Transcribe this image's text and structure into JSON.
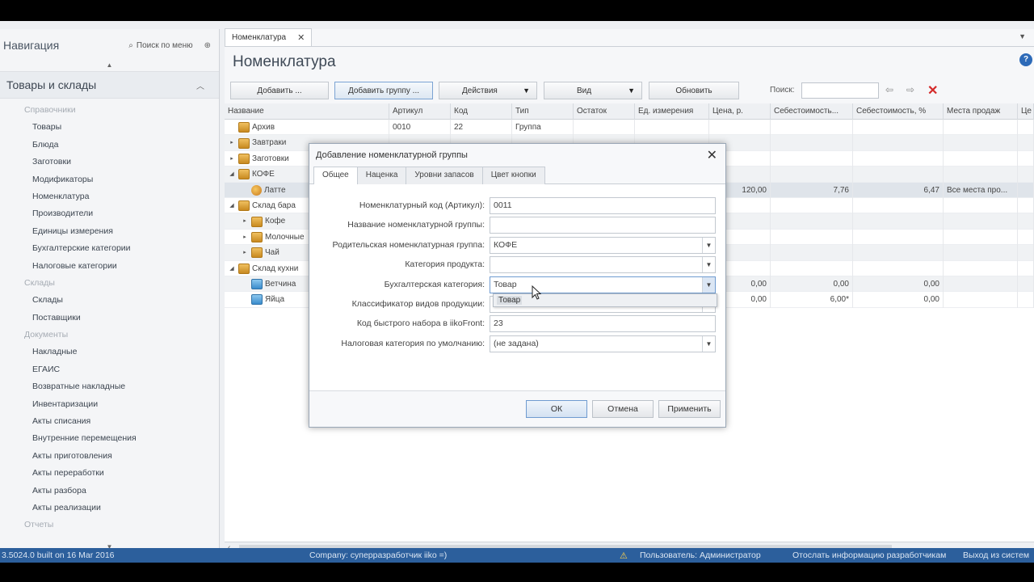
{
  "nav": {
    "title": "Навигация",
    "search_label": "Поиск по меню",
    "section_title": "Товары и склады",
    "groups": [
      {
        "type": "group",
        "label": "Справочники"
      },
      {
        "type": "item",
        "label": "Товары"
      },
      {
        "type": "item",
        "label": "Блюда"
      },
      {
        "type": "item",
        "label": "Заготовки"
      },
      {
        "type": "item",
        "label": "Модификаторы"
      },
      {
        "type": "item",
        "label": "Номенклатура"
      },
      {
        "type": "item",
        "label": "Производители"
      },
      {
        "type": "item",
        "label": "Единицы измерения"
      },
      {
        "type": "item",
        "label": "Бухгалтерские категории"
      },
      {
        "type": "item",
        "label": "Налоговые категории"
      },
      {
        "type": "group",
        "label": "Склады"
      },
      {
        "type": "item",
        "label": "Склады"
      },
      {
        "type": "item",
        "label": "Поставщики"
      },
      {
        "type": "group",
        "label": "Документы"
      },
      {
        "type": "item",
        "label": "Накладные"
      },
      {
        "type": "item",
        "label": "ЕГАИС"
      },
      {
        "type": "item",
        "label": "Возвратные накладные"
      },
      {
        "type": "item",
        "label": "Инвентаризации"
      },
      {
        "type": "item",
        "label": "Акты списания"
      },
      {
        "type": "item",
        "label": "Внутренние перемещения"
      },
      {
        "type": "item",
        "label": "Акты приготовления"
      },
      {
        "type": "item",
        "label": "Акты переработки"
      },
      {
        "type": "item",
        "label": "Акты разбора"
      },
      {
        "type": "item",
        "label": "Акты реализации"
      },
      {
        "type": "group",
        "label": "Отчеты"
      }
    ]
  },
  "main": {
    "tab_label": "Номенклатура",
    "page_title": "Номенклатура",
    "toolbar": {
      "add": "Добавить ...",
      "add_group": "Добавить группу ...",
      "actions": "Действия",
      "view": "Вид",
      "refresh": "Обновить",
      "search_label": "Поиск:",
      "search_value": ""
    },
    "columns": [
      "Название",
      "Артикул",
      "Код",
      "Тип",
      "Остаток",
      "Ед. измерения",
      "Цена, р.",
      "Себестоимость...",
      "Себестоимость, %",
      "Места продаж",
      "Це"
    ],
    "rows": [
      {
        "level": 0,
        "expand": "",
        "icon": "folder",
        "name": "Архив",
        "article": "0010",
        "code": "22",
        "type": "Группа",
        "stock": "",
        "unit": "",
        "price": "",
        "cost": "",
        "cost_pct": "",
        "places": "",
        "style": ""
      },
      {
        "level": 0,
        "expand": "▸",
        "icon": "folder",
        "name": "Завтраки",
        "article": "",
        "code": "",
        "type": "",
        "stock": "",
        "unit": "",
        "price": "",
        "cost": "",
        "cost_pct": "",
        "places": "",
        "style": "alt"
      },
      {
        "level": 0,
        "expand": "▸",
        "icon": "folder",
        "name": "Заготовки",
        "article": "",
        "code": "",
        "type": "",
        "stock": "",
        "unit": "",
        "price": "",
        "cost": "",
        "cost_pct": "",
        "places": "",
        "style": ""
      },
      {
        "level": 0,
        "expand": "◢",
        "icon": "folder",
        "name": "КОФЕ",
        "article": "",
        "code": "",
        "type": "",
        "stock": "",
        "unit": "",
        "price": "",
        "cost": "",
        "cost_pct": "",
        "places": "",
        "style": "alt"
      },
      {
        "level": 1,
        "expand": "",
        "icon": "food",
        "name": "Латте",
        "article": "",
        "code": "",
        "type": "",
        "stock": "",
        "unit": "",
        "price": "120,00",
        "cost": "7,76",
        "cost_pct": "6,47",
        "places": "Все места про...",
        "style": "sel"
      },
      {
        "level": 0,
        "expand": "◢",
        "icon": "folder",
        "name": "Склад бара",
        "article": "",
        "code": "",
        "type": "",
        "stock": "",
        "unit": "",
        "price": "",
        "cost": "",
        "cost_pct": "",
        "places": "",
        "style": ""
      },
      {
        "level": 1,
        "expand": "▸",
        "icon": "folder",
        "name": "Кофе",
        "article": "",
        "code": "",
        "type": "",
        "stock": "",
        "unit": "",
        "price": "",
        "cost": "",
        "cost_pct": "",
        "places": "",
        "style": "alt"
      },
      {
        "level": 1,
        "expand": "▸",
        "icon": "folder",
        "name": "Молочные",
        "article": "",
        "code": "",
        "type": "",
        "stock": "",
        "unit": "",
        "price": "",
        "cost": "",
        "cost_pct": "",
        "places": "",
        "style": ""
      },
      {
        "level": 1,
        "expand": "▸",
        "icon": "folder",
        "name": "Чай",
        "article": "",
        "code": "",
        "type": "",
        "stock": "",
        "unit": "",
        "price": "",
        "cost": "",
        "cost_pct": "",
        "places": "",
        "style": "alt"
      },
      {
        "level": 0,
        "expand": "◢",
        "icon": "folder",
        "name": "Склад кухни",
        "article": "",
        "code": "",
        "type": "",
        "stock": "",
        "unit": "",
        "price": "",
        "cost": "",
        "cost_pct": "",
        "places": "",
        "style": ""
      },
      {
        "level": 1,
        "expand": "",
        "icon": "item",
        "name": "Ветчина",
        "article": "",
        "code": "",
        "type": "",
        "stock": "",
        "unit": "",
        "price": "0,00",
        "cost": "0,00",
        "cost_pct": "0,00",
        "places": "",
        "style": "alt"
      },
      {
        "level": 1,
        "expand": "",
        "icon": "item",
        "name": "Яйца",
        "article": "",
        "code": "",
        "type": "",
        "stock": "",
        "unit": "",
        "price": "0,00",
        "cost": "6,00*",
        "cost_pct": "0,00",
        "places": "",
        "style": ""
      }
    ]
  },
  "dialog": {
    "title": "Добавление номенклатурной группы",
    "tabs": [
      "Общее",
      "Наценка",
      "Уровни запасов",
      "Цвет кнопки"
    ],
    "fields": [
      {
        "label": "Номенклатурный код (Артикул):",
        "value": "0011",
        "combo": false
      },
      {
        "label": "Название номенклатурной группы:",
        "value": "",
        "combo": false
      },
      {
        "label": "Родительская номенклатурная группа:",
        "value": "КОФЕ",
        "combo": true
      },
      {
        "label": "Категория продукта:",
        "value": "",
        "combo": true
      },
      {
        "label": "Бухгалтерская категория:",
        "value": "Товар",
        "combo": true
      },
      {
        "label": "Классификатор видов продукции:",
        "value": "",
        "combo": true
      },
      {
        "label": "Код быстрого набора в iikoFront:",
        "value": "23",
        "combo": false
      },
      {
        "label": "Налоговая категория по умолчанию:",
        "value": "(не задана)",
        "combo": true
      }
    ],
    "dropdown_option": "Товар",
    "ok": "ОК",
    "cancel": "Отмена",
    "apply": "Применить"
  },
  "status": {
    "version": "3.5024.0 built on 16 Mar 2016",
    "company": "Company: суперразработчик iiko =)",
    "user": "Пользователь: Администратор",
    "send_info": "Отослать информацию разработчикам",
    "exit": "Выход из систем"
  },
  "colors": {
    "statusbar": "#2c5f9c",
    "close_x": "#d42a2a",
    "accent": "#6f9bd0"
  }
}
